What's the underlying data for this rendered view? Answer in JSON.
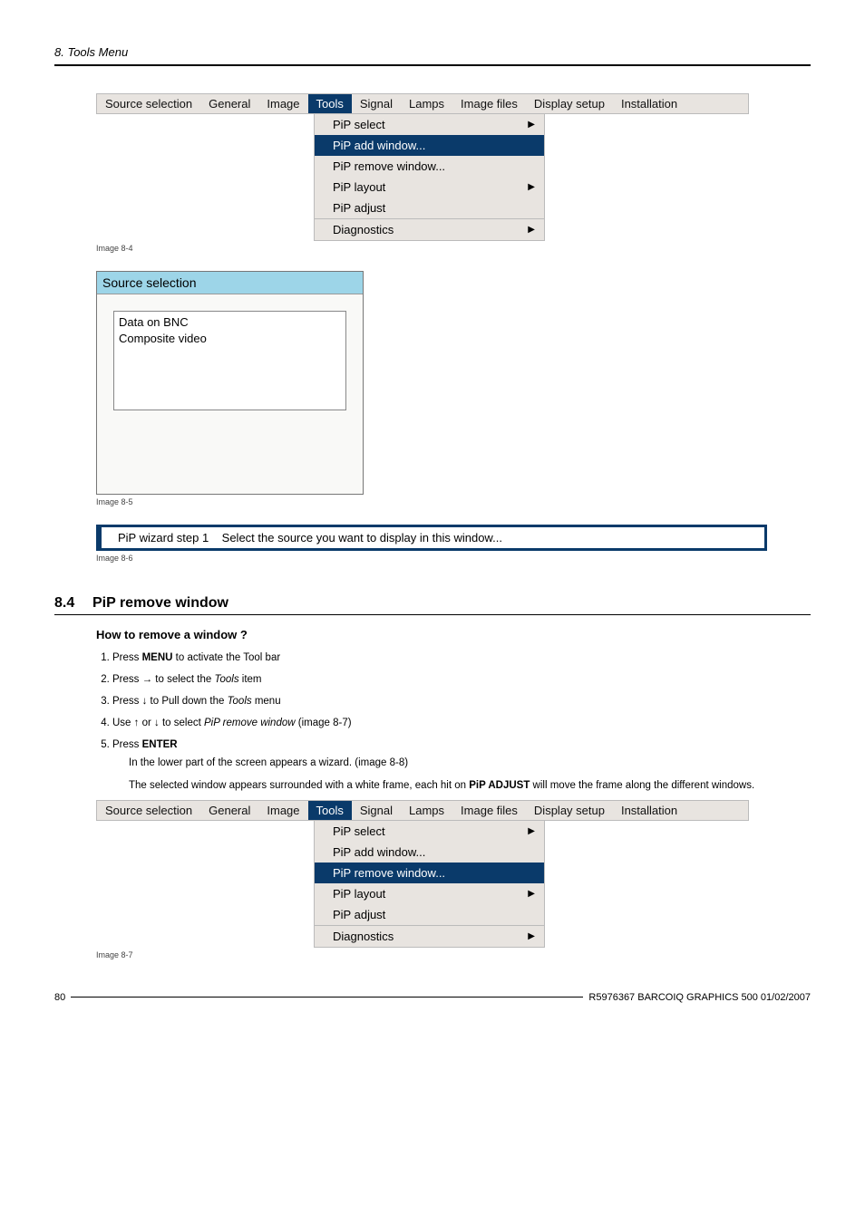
{
  "header": {
    "title": "8. Tools Menu"
  },
  "menubar": {
    "items": [
      "Source selection",
      "General",
      "Image",
      "Tools",
      "Signal",
      "Lamps",
      "Image files",
      "Display setup",
      "Installation"
    ],
    "selectedIndex": 3
  },
  "dropdown": {
    "rows": [
      {
        "label": "PiP select",
        "arrow": true
      },
      {
        "label": "PiP add window...",
        "arrow": false
      },
      {
        "label": "PiP remove window...",
        "arrow": false
      },
      {
        "label": "PiP layout",
        "arrow": true
      },
      {
        "label": "PiP adjust",
        "arrow": false
      },
      {
        "label": "Diagnostics",
        "arrow": true
      }
    ]
  },
  "fig84": {
    "highlightIndex": 1,
    "caption": "Image 8-4"
  },
  "fig85": {
    "windowTitle": "Source selection",
    "list": [
      "Data on BNC",
      "Composite video"
    ],
    "caption": "Image 8-5"
  },
  "fig86": {
    "label": "PiP wizard step 1",
    "text": "Select the source you want to display in this window...",
    "caption": "Image 8-6"
  },
  "section84": {
    "num": "8.4",
    "title": "PiP remove window",
    "subhead": "How to remove a window ?",
    "steps": {
      "s1a": "Press ",
      "s1b": "MENU",
      "s1c": " to activate the Tool bar",
      "s2a": "Press → to select the ",
      "s2b": "Tools",
      "s2c": " item",
      "s3a": "Press ↓ to Pull down the ",
      "s3b": "Tools",
      "s3c": " menu",
      "s4a": "Use ↑ or ↓ to select ",
      "s4b": "PiP remove window",
      "s4c": " (image 8-7)",
      "s5a": "Press ",
      "s5b": "ENTER"
    },
    "after1": "In the lower part of the screen appears a wizard. (image 8-8)",
    "after2a": "The selected window appears surrounded with a white frame, each hit on ",
    "after2b": "PiP ADJUST",
    "after2c": " will move the frame along the different windows."
  },
  "fig87": {
    "highlightIndex": 2,
    "caption": "Image 8-7"
  },
  "footer": {
    "page": "80",
    "text": "R5976367  BARCOIQ GRAPHICS 500  01/02/2007"
  }
}
